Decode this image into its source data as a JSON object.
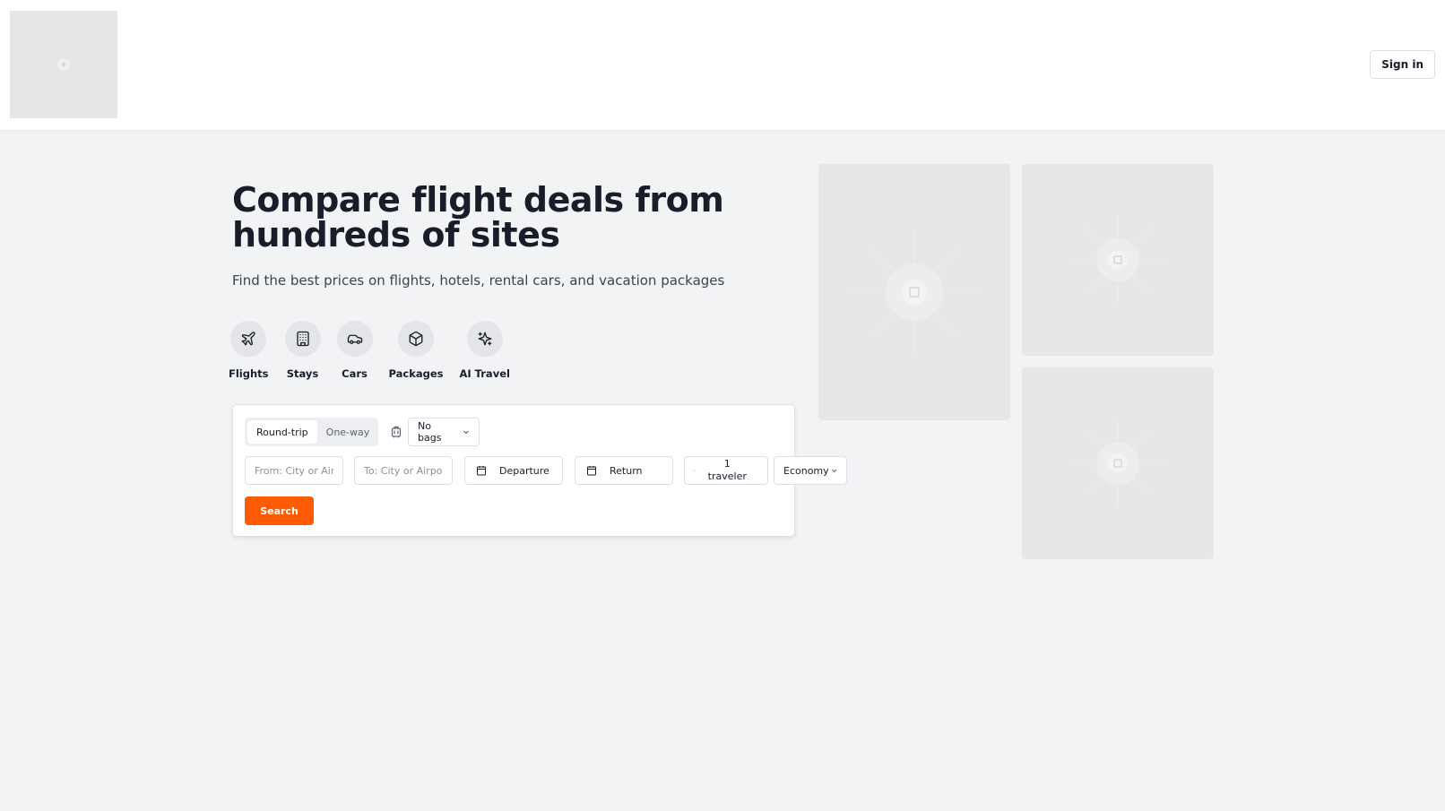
{
  "header": {
    "sign_in_label": "Sign in"
  },
  "hero": {
    "title": "Compare flight deals from hundreds of sites",
    "subtitle": "Find the best prices on flights, hotels, rental cars, and vacation packages"
  },
  "verticals": [
    {
      "label": "Flights",
      "icon": "plane-icon"
    },
    {
      "label": "Stays",
      "icon": "building-icon"
    },
    {
      "label": "Cars",
      "icon": "car-icon"
    },
    {
      "label": "Packages",
      "icon": "box-icon"
    },
    {
      "label": "AI Travel",
      "icon": "sparkle-icon"
    }
  ],
  "search": {
    "trip_types": [
      "Round-trip",
      "One-way"
    ],
    "selected_trip_type": "Round-trip",
    "bags": "No bags",
    "from_placeholder": "From: City or Airport",
    "to_placeholder": "To: City or Airport",
    "departure_label": "Departure",
    "return_label": "Return",
    "travelers_count": "1",
    "travelers_label": "traveler",
    "cabin_class": "Economy",
    "search_label": "Search"
  },
  "colors": {
    "accent": "#ff5b00",
    "background": "#f2f3f5",
    "text": "#1a1d29"
  }
}
